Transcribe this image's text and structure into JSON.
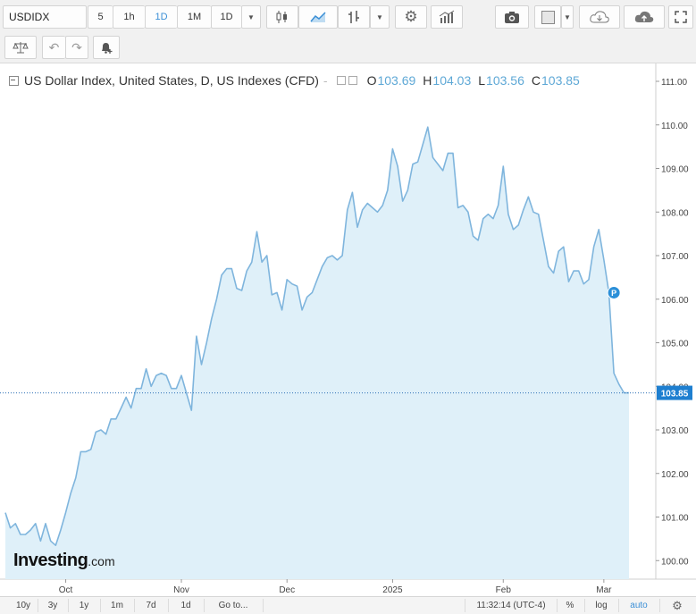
{
  "toolbar": {
    "symbol": "USDIDX",
    "intervals": [
      "5",
      "1h",
      "1D",
      "1M",
      "1D"
    ],
    "active_interval": "1D"
  },
  "legend": {
    "title": "US Dollar Index, United States, D, US Indexes (CFD)",
    "dash": "-",
    "o_label": "O",
    "o": "103.69",
    "h_label": "H",
    "h": "104.03",
    "l_label": "L",
    "l": "103.56",
    "c_label": "C",
    "c": "103.85"
  },
  "watermark": "Investing",
  "watermark_suffix": ".com",
  "marker_label": "P",
  "bottombar": {
    "ranges": [
      "10y",
      "3y",
      "1y",
      "1m",
      "7d",
      "1d"
    ],
    "goto": "Go to...",
    "time": "11:32:14 (UTC-4)",
    "percent": "%",
    "log": "log",
    "auto": "auto"
  },
  "colors": {
    "line": "#7fb5dd",
    "fill": "#dff0f9",
    "accent": "#3b8fd6",
    "price_tag": "#1e7fd0"
  },
  "chart_data": {
    "type": "area",
    "title": "",
    "xlabel": "",
    "ylabel": "",
    "ylim": [
      99.6,
      111.3
    ],
    "y_ticks": [
      "111.00",
      "110.00",
      "109.00",
      "108.00",
      "107.00",
      "106.00",
      "105.00",
      "104.00",
      "103.00",
      "102.00",
      "101.00",
      "100.00"
    ],
    "x_ticks": [
      {
        "label": "Oct",
        "index": 12
      },
      {
        "label": "Nov",
        "index": 35
      },
      {
        "label": "Dec",
        "index": 56
      },
      {
        "label": "2025",
        "index": 77
      },
      {
        "label": "Feb",
        "index": 99
      },
      {
        "label": "Mar",
        "index": 119
      }
    ],
    "last_value": 103.85,
    "last_value_label": "103.85",
    "marker": {
      "index": 121,
      "value": 106.15
    },
    "values": [
      101.1,
      100.75,
      100.85,
      100.6,
      100.6,
      100.7,
      100.85,
      100.45,
      100.85,
      100.45,
      100.35,
      100.7,
      101.1,
      101.55,
      101.9,
      102.5,
      102.5,
      102.55,
      102.95,
      103.0,
      102.9,
      103.25,
      103.25,
      103.5,
      103.75,
      103.5,
      103.95,
      103.95,
      104.4,
      104.0,
      104.25,
      104.3,
      104.25,
      103.95,
      103.95,
      104.25,
      103.85,
      103.45,
      105.15,
      104.5,
      105.0,
      105.55,
      106.0,
      106.55,
      106.7,
      106.7,
      106.25,
      106.2,
      106.65,
      106.85,
      107.55,
      106.85,
      107.0,
      106.1,
      106.15,
      105.75,
      106.45,
      106.35,
      106.3,
      105.75,
      106.05,
      106.15,
      106.45,
      106.75,
      106.95,
      107.0,
      106.9,
      107.0,
      108.05,
      108.45,
      107.65,
      108.05,
      108.2,
      108.1,
      108.0,
      108.15,
      108.5,
      109.45,
      109.05,
      108.25,
      108.5,
      109.1,
      109.15,
      109.55,
      109.95,
      109.25,
      109.1,
      108.95,
      109.35,
      109.35,
      108.1,
      108.15,
      108.0,
      107.45,
      107.35,
      107.85,
      107.95,
      107.85,
      108.15,
      109.05,
      107.95,
      107.6,
      107.7,
      108.05,
      108.35,
      108.0,
      107.95,
      107.35,
      106.75,
      106.6,
      107.1,
      107.2,
      106.4,
      106.65,
      106.65,
      106.35,
      106.45,
      107.2,
      107.6,
      106.9,
      106.15,
      104.3,
      104.05,
      103.85,
      103.85
    ]
  }
}
